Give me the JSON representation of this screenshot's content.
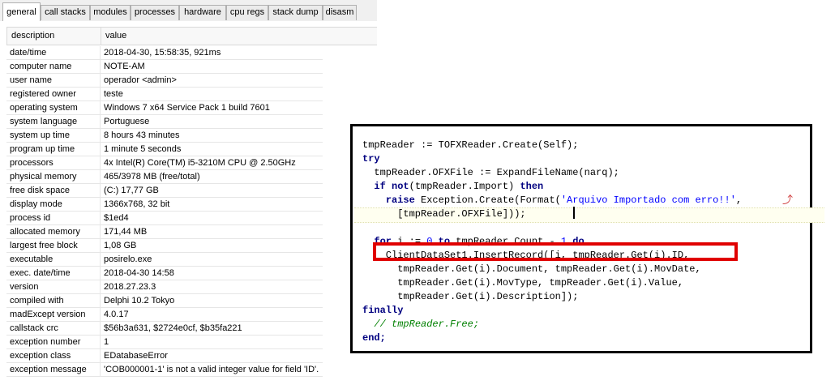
{
  "tabs": [
    "general",
    "call stacks",
    "modules",
    "processes",
    "hardware",
    "cpu regs",
    "stack dump",
    "disasm"
  ],
  "grid": {
    "header": {
      "description": "description",
      "value": "value"
    },
    "rows": [
      {
        "d": "date/time",
        "v": "2018-04-30, 15:58:35, 921ms"
      },
      {
        "d": "computer name",
        "v": "NOTE-AM"
      },
      {
        "d": "user name",
        "v": "operador  <admin>"
      },
      {
        "d": "registered owner",
        "v": "teste"
      },
      {
        "d": "operating system",
        "v": "Windows 7 x64 Service Pack 1 build 7601"
      },
      {
        "d": "system language",
        "v": "Portuguese"
      },
      {
        "d": "system up time",
        "v": "8 hours 43 minutes"
      },
      {
        "d": "program up time",
        "v": "1 minute 5 seconds"
      },
      {
        "d": "processors",
        "v": "4x Intel(R) Core(TM) i5-3210M CPU @ 2.50GHz"
      },
      {
        "d": "physical memory",
        "v": "465/3978 MB (free/total)"
      },
      {
        "d": "free disk space",
        "v": "(C:) 17,77 GB"
      },
      {
        "d": "display mode",
        "v": "1366x768, 32 bit"
      },
      {
        "d": "process id",
        "v": "$1ed4"
      },
      {
        "d": "allocated memory",
        "v": "171,44 MB"
      },
      {
        "d": "largest free block",
        "v": "1,08 GB"
      },
      {
        "d": "executable",
        "v": "posirelo.exe"
      },
      {
        "d": "exec. date/time",
        "v": "2018-04-30 14:58"
      },
      {
        "d": "version",
        "v": "2018.27.23.3"
      },
      {
        "d": "compiled with",
        "v": "Delphi 10.2 Tokyo"
      },
      {
        "d": "madExcept version",
        "v": "4.0.17"
      },
      {
        "d": "callstack crc",
        "v": "$56b3a631, $2724e0cf, $b35fa221"
      },
      {
        "d": "exception number",
        "v": "1"
      },
      {
        "d": "exception class",
        "v": "EDatabaseError"
      },
      {
        "d": "exception message",
        "v": "'COB000001-1' is not a valid integer value for field 'ID'."
      }
    ]
  },
  "code": {
    "l1a": "tmpReader := TOFXReader.Create(Self);",
    "l2a": "try",
    "l3a": "  tmpReader.OFXFile := ExpandFileName(narq);",
    "l4a": "  ",
    "l4b": "if",
    "l4c": " ",
    "l4d": "not",
    "l4e": "(tmpReader.Import) ",
    "l4f": "then",
    "l5a": "    ",
    "l5b": "raise",
    "l5c": " Exception.Create(Format(",
    "l5d": "'Arquivo Importado com erro!!'",
    "l5e": ",",
    "l6a": "      [tmpReader.OFXFile]));",
    "l8a": "  ",
    "l8b": "for",
    "l8c": " i := ",
    "l8d": "0",
    "l8e": " ",
    "l8f": "to",
    "l8g": " tmpReader.Count - ",
    "l8h": "1",
    "l8i": " ",
    "l8j": "do",
    "l9a": "    ClientDataSet1.InsertRecord([i, tmpReader.Get(i).ID,",
    "l10a": "      tmpReader.Get(i).Document, tmpReader.Get(i).MovDate,",
    "l11a": "      tmpReader.Get(i).MovType, tmpReader.Get(i).Value,",
    "l12a": "      tmpReader.Get(i).Description]);",
    "l13a": "finally",
    "l14a": "  ",
    "l14b": "// tmpReader.Free;",
    "l15a": "end;"
  },
  "icons": {
    "wrap": "wrap-arrow-icon"
  }
}
